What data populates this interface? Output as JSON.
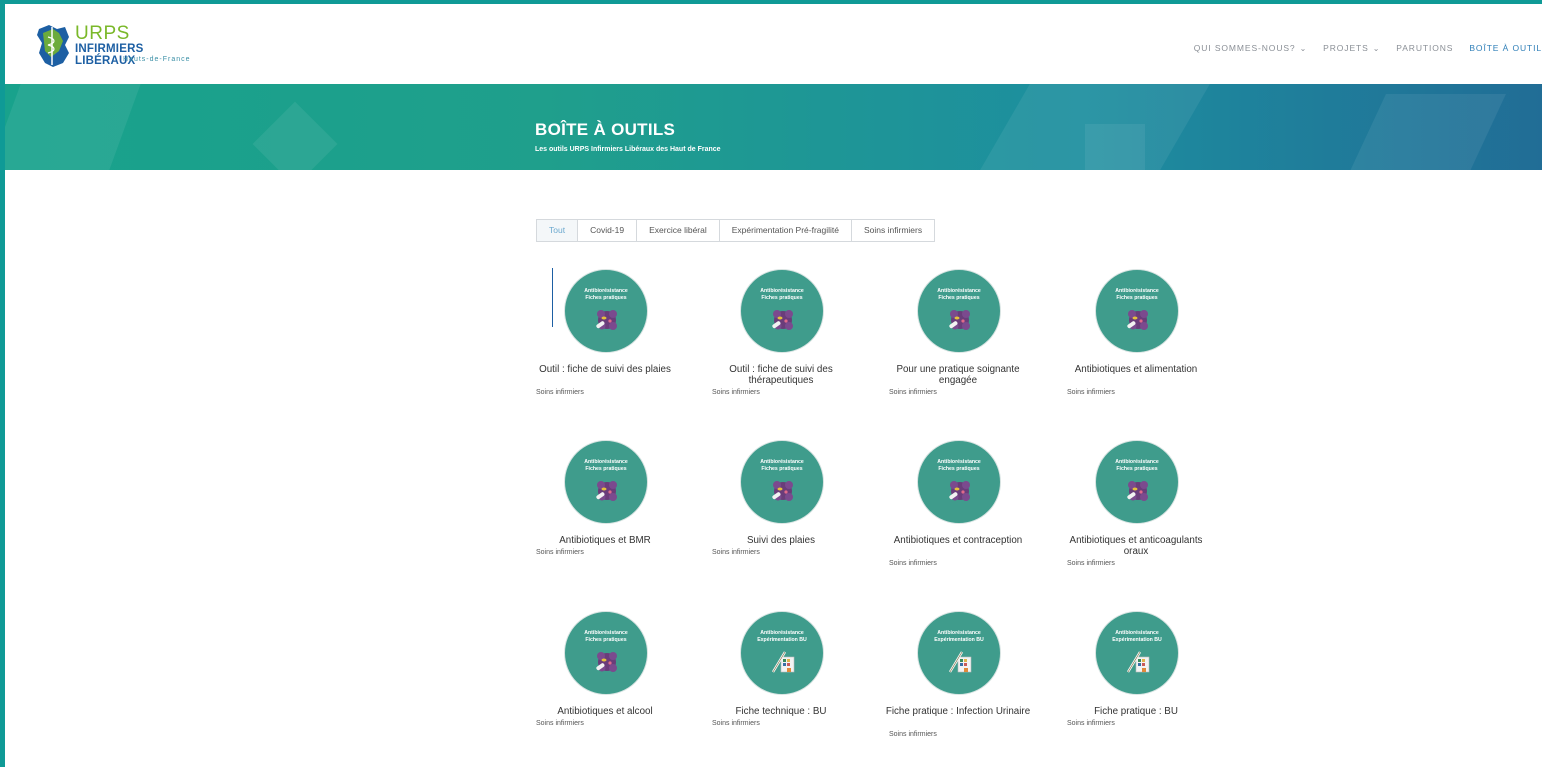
{
  "logo": {
    "line1": "URPS",
    "line2": "INFIRMIERS LIBÉRAUX",
    "line3": "Hauts-de-France"
  },
  "nav": [
    {
      "label": "QUI SOMMES-NOUS?",
      "dropdown": true
    },
    {
      "label": "PROJETS",
      "dropdown": true
    },
    {
      "label": "PARUTIONS",
      "dropdown": false
    },
    {
      "label": "BOÎTE À OUTIL",
      "dropdown": false,
      "active": true
    }
  ],
  "hero": {
    "title": "BOÎTE À OUTILS",
    "subtitle": "Les outils URPS Infirmiers Libéraux des Haut de France"
  },
  "filters": [
    "Tout",
    "Covid-19",
    "Exercice libéral",
    "Expérimentation Pré-fragilité",
    "Soins infirmiers"
  ],
  "active_filter": "Tout",
  "items": [
    {
      "title": "Outil : fiche de suivi des plaies",
      "category": "Soins infirmiers",
      "thumb_line1": "Antibiorésistance",
      "thumb_line2": "Fiches pratiques",
      "icon": "bacteria-icon"
    },
    {
      "title": "Outil : fiche de suivi des thérapeutiques",
      "category": "Soins infirmiers",
      "thumb_line1": "Antibiorésistance",
      "thumb_line2": "Fiches pratiques",
      "icon": "bacteria-icon"
    },
    {
      "title": "Pour une pratique soignante engagée",
      "category": "Soins infirmiers",
      "thumb_line1": "Antibiorésistance",
      "thumb_line2": "Fiches pratiques",
      "icon": "bacteria-icon"
    },
    {
      "title": "Antibiotiques et alimentation",
      "category": "Soins infirmiers",
      "thumb_line1": "Antibiorésistance",
      "thumb_line2": "Fiches pratiques",
      "icon": "bacteria-icon"
    },
    {
      "title": "Antibiotiques et BMR",
      "category": "Soins infirmiers",
      "thumb_line1": "Antibiorésistance",
      "thumb_line2": "Fiches pratiques",
      "icon": "bacteria-icon"
    },
    {
      "title": "Suivi des plaies",
      "category": "Soins infirmiers",
      "thumb_line1": "Antibiorésistance",
      "thumb_line2": "Fiches pratiques",
      "icon": "bacteria-icon"
    },
    {
      "title": "Antibiotiques et contraception",
      "category": "Soins infirmiers",
      "thumb_line1": "Antibiorésistance",
      "thumb_line2": "Fiches pratiques",
      "icon": "bacteria-icon"
    },
    {
      "title": "Antibiotiques et anticoagulants oraux",
      "category": "Soins infirmiers",
      "thumb_line1": "Antibiorésistance",
      "thumb_line2": "Fiches pratiques",
      "icon": "bacteria-icon"
    },
    {
      "title": "Antibiotiques et alcool",
      "category": "Soins infirmiers",
      "thumb_line1": "Antibiorésistance",
      "thumb_line2": "Fiches pratiques",
      "icon": "bacteria-icon"
    },
    {
      "title": "Fiche technique : BU",
      "category": "Soins infirmiers",
      "thumb_line1": "Antibiorésistance",
      "thumb_line2": "Expérimentation BU",
      "icon": "urine-test-icon"
    },
    {
      "title": "Fiche pratique : Infection Urinaire",
      "category": "Soins infirmiers",
      "thumb_line1": "Antibiorésistance",
      "thumb_line2": "Expérimentation BU",
      "icon": "urine-test-icon"
    },
    {
      "title": "Fiche pratique : BU",
      "category": "Soins infirmiers",
      "thumb_line1": "Antibiorésistance",
      "thumb_line2": "Expérimentation BU",
      "icon": "urine-test-icon"
    }
  ],
  "colors": {
    "frame": "#0f9a96",
    "thumb": "#3f9c8c",
    "nav_active": "#2f7fb8",
    "filter_active": "#6ca9cf"
  }
}
